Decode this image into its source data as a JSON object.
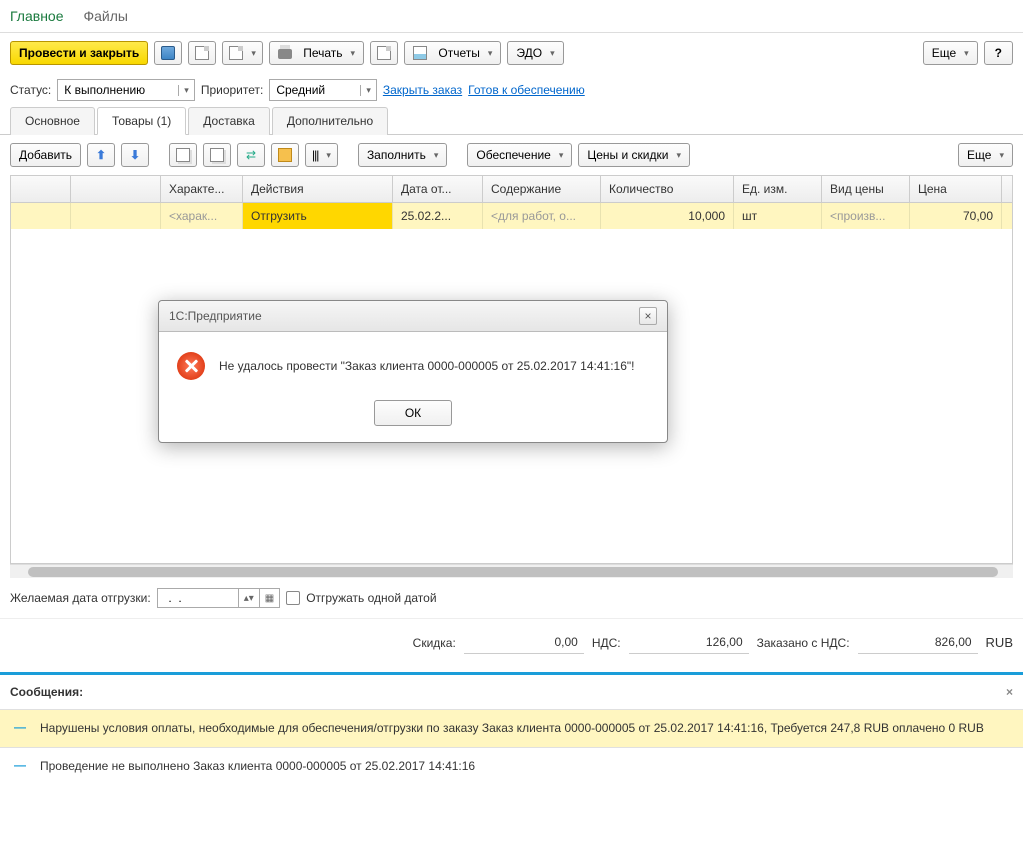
{
  "topTabs": {
    "main": "Главное",
    "files": "Файлы"
  },
  "toolbar": {
    "postClose": "Провести и закрыть",
    "print": "Печать",
    "reports": "Отчеты",
    "edo": "ЭДО",
    "more": "Еще",
    "help": "?"
  },
  "statusRow": {
    "statusLabel": "Статус:",
    "statusValue": "К выполнению",
    "priorityLabel": "Приоритет:",
    "priorityValue": "Средний",
    "closeOrder": "Закрыть заказ",
    "readySupply": "Готов к обеспечению"
  },
  "tabs": {
    "main": "Основное",
    "goods": "Товары (1)",
    "delivery": "Доставка",
    "extra": "Дополнительно"
  },
  "subbar": {
    "add": "Добавить",
    "fill": "Заполнить",
    "supply": "Обеспечение",
    "pricesDiscounts": "Цены и скидки",
    "more": "Еще"
  },
  "grid": {
    "headers": {
      "char": "Характе...",
      "actions": "Действия",
      "dateFrom": "Дата от...",
      "content": "Содержание",
      "qty": "Количество",
      "unit": "Ед. изм.",
      "priceType": "Вид цены",
      "price": "Цена"
    },
    "row": {
      "charPlaceholder": "<харак...",
      "action": "Отгрузить",
      "date": "25.02.2...",
      "contentPlaceholder": "<для работ, о...",
      "qty": "10,000",
      "unit": "шт",
      "priceType": "<произв...",
      "price": "70,00"
    }
  },
  "dialog": {
    "title": "1С:Предприятие",
    "message": "Не удалось провести \"Заказ клиента 0000-000005 от 25.02.2017 14:41:16\"!",
    "ok": "ОК"
  },
  "shipDate": {
    "label": "Желаемая дата отгрузки:",
    "value": "  .  .    ",
    "singleDate": "Отгружать одной датой"
  },
  "totals": {
    "discountLabel": "Скидка:",
    "discount": "0,00",
    "vatLabel": "НДС:",
    "vat": "126,00",
    "orderedLabel": "Заказано с НДС:",
    "ordered": "826,00",
    "currency": "RUB"
  },
  "messages": {
    "header": "Сообщения:",
    "items": [
      "Нарушены условия оплаты, необходимые для обеспечения/отгрузки по заказу Заказ клиента 0000-000005 от 25.02.2017 14:41:16, Требуется 247,8 RUB оплачено 0 RUB",
      "Проведение не выполнено Заказ клиента 0000-000005 от 25.02.2017 14:41:16"
    ]
  }
}
